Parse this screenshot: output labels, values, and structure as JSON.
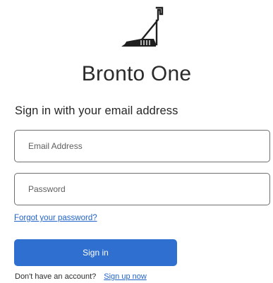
{
  "app": {
    "title": "Bronto One",
    "logo_icon": "dinosaur-logo-icon"
  },
  "form": {
    "heading": "Sign in with your email address",
    "email": {
      "placeholder": "Email Address",
      "value": ""
    },
    "password": {
      "placeholder": "Password",
      "value": ""
    },
    "forgot_password_link": "Forgot your password?",
    "submit_label": "Sign in",
    "signup_prompt": "Don't have an account?",
    "signup_link": "Sign up now"
  },
  "colors": {
    "primary": "#2f6fd0",
    "link": "#1f62c9",
    "border": "#6f6f6f",
    "text": "#262626"
  }
}
